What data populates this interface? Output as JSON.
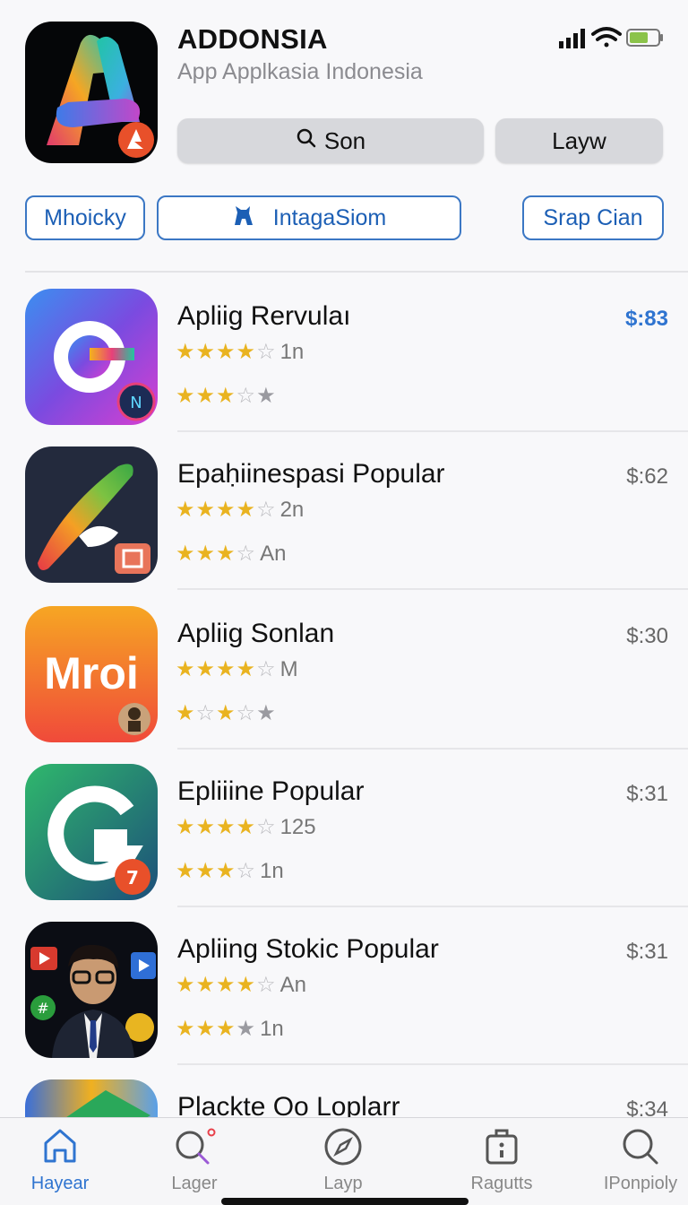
{
  "header": {
    "title": "ADDONSIA",
    "subtitle": "App Applkasia Indonesia",
    "search_label": "Son",
    "second_button_label": "Layw"
  },
  "status_bar": {
    "signal": "signal-bars-icon",
    "wifi": "wifi-icon",
    "battery": "battery-icon"
  },
  "chips": [
    {
      "label": "Mhoicky"
    },
    {
      "label": "IntagaSiom",
      "icon": "cat-icon"
    },
    {
      "label": "Srap Cian"
    }
  ],
  "apps": [
    {
      "name": "Apliig Rervulaı",
      "price": "$:83",
      "price_highlight": true,
      "rating1": {
        "filled": 4,
        "count": "1n"
      },
      "rating2": {
        "filled": 3,
        "count": ""
      }
    },
    {
      "name": "Epaḥiinespasi Popular",
      "price": "$:62",
      "price_highlight": false,
      "rating1": {
        "filled": 4,
        "count": "2n"
      },
      "rating2": {
        "filled": 3,
        "count": "An"
      }
    },
    {
      "name": "Apliig Sonlan",
      "price": "$:30",
      "price_highlight": false,
      "rating1": {
        "filled": 4,
        "count": "M"
      },
      "rating2": {
        "filled": 2,
        "count": ""
      }
    },
    {
      "name": "Epliiine Popular",
      "price": "$:31",
      "price_highlight": false,
      "rating1": {
        "filled": 4,
        "count": "125"
      },
      "rating2": {
        "filled": 3,
        "count": "1n"
      }
    },
    {
      "name": "Apliing Stokic Popular",
      "price": "$:31",
      "price_highlight": false,
      "rating1": {
        "filled": 4,
        "count": "An"
      },
      "rating2": {
        "filled": 3,
        "count": "1n"
      }
    },
    {
      "name": "Plackte Oo Loplarr",
      "price": "$:34",
      "price_highlight": false,
      "rating1": {
        "filled": 0,
        "count": ""
      },
      "rating2": {
        "filled": 0,
        "count": ""
      }
    }
  ],
  "icon_texts": {
    "mroi": "Mroi"
  },
  "tabs": [
    {
      "label": "Hayear",
      "icon": "home-icon",
      "active": true
    },
    {
      "label": "Lager",
      "icon": "search-icon",
      "active": false
    },
    {
      "label": "Layp",
      "icon": "compass-icon",
      "active": false
    },
    {
      "label": "Ragutts",
      "icon": "bag-icon",
      "active": false
    },
    {
      "label": "IPonpioly",
      "icon": "search-icon",
      "active": false
    }
  ],
  "colors": {
    "accent": "#2f74d0",
    "star": "#e9b320"
  }
}
